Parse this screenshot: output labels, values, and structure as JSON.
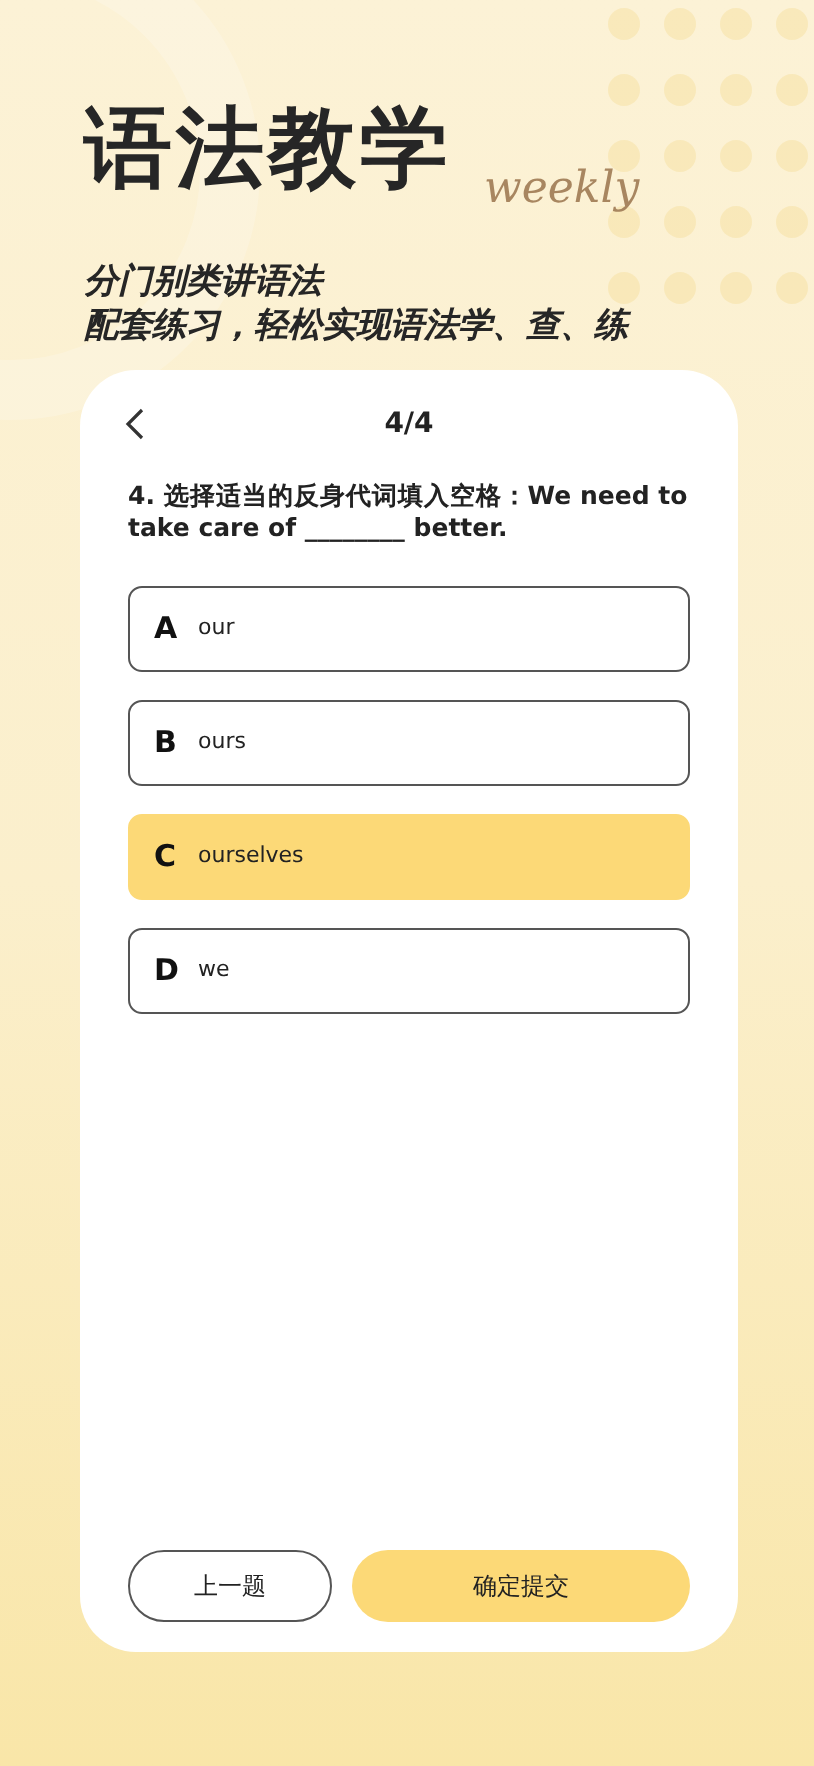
{
  "banner": {
    "title": "语法教学",
    "decor_text": "weekly",
    "subtitle_lines": [
      "分门别类讲语法",
      "配套练习，轻松实现语法学、查、练"
    ]
  },
  "header": {
    "progress": "4/4"
  },
  "question": {
    "text": "4. 选择适当的反身代词填入空格：We need to take care of ________ better."
  },
  "options": [
    {
      "letter": "A",
      "text": "our",
      "selected": false
    },
    {
      "letter": "B",
      "text": "ours",
      "selected": false
    },
    {
      "letter": "C",
      "text": "ourselves",
      "selected": true
    },
    {
      "letter": "D",
      "text": "we",
      "selected": false
    }
  ],
  "buttons": [
    {
      "kind": "secondary",
      "label": "上一题"
    },
    {
      "kind": "primary",
      "label": "确定提交"
    }
  ]
}
